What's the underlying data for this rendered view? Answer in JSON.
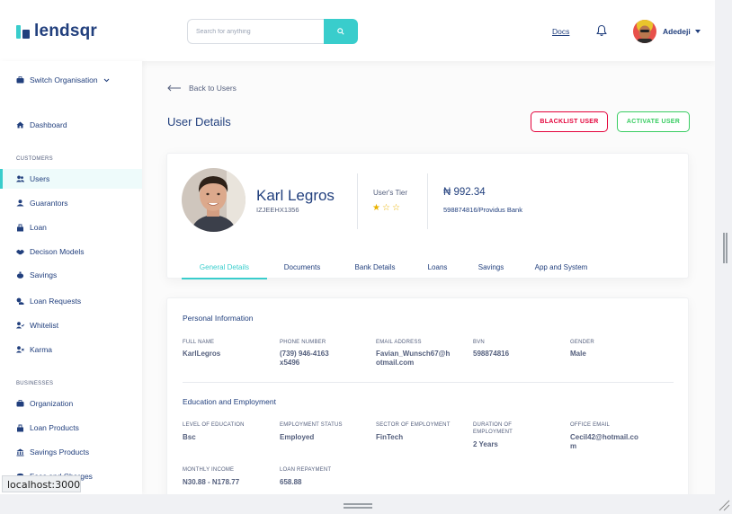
{
  "brand": {
    "name": "lendsqr"
  },
  "topbar": {
    "search_placeholder": "Search for anything",
    "docs": "Docs",
    "user_name": "Adedeji"
  },
  "sidebar": {
    "switch_org": "Switch Organisation",
    "dashboard": "Dashboard",
    "sections": {
      "customers": "CUSTOMERS",
      "businesses": "BUSINESSES"
    },
    "customers": [
      {
        "label": "Users",
        "icon": "users-icon",
        "active": true
      },
      {
        "label": "Guarantors",
        "icon": "guarantors-icon"
      },
      {
        "label": "Loan",
        "icon": "loan-icon"
      },
      {
        "label": "Decison Models",
        "icon": "handshake-icon"
      },
      {
        "label": "Savings",
        "icon": "piggy-bank-icon"
      },
      {
        "label": "Loan Requests",
        "icon": "loan-request-icon"
      },
      {
        "label": "Whitelist",
        "icon": "user-check-icon"
      },
      {
        "label": "Karma",
        "icon": "user-times-icon"
      }
    ],
    "businesses": [
      {
        "label": "Organization",
        "icon": "briefcase-icon"
      },
      {
        "label": "Loan Products",
        "icon": "loan-products-icon"
      },
      {
        "label": "Savings Products",
        "icon": "bank-icon"
      },
      {
        "label": "Fees and Charges",
        "icon": "coins-icon"
      }
    ]
  },
  "page": {
    "back": "Back to Users",
    "title": "User Details",
    "blacklist": "BLACKLIST USER",
    "activate": "ACTIVATE USER"
  },
  "profile": {
    "name": "Karl Legros",
    "id": "IZJEEHX1356",
    "tier_label": "User's Tier",
    "tier_rating": 1,
    "tier_max": 3,
    "balance": "₦ 992.34",
    "bank": "598874816/Providus Bank"
  },
  "tabs": [
    {
      "label": "General Details",
      "active": true
    },
    {
      "label": "Documents"
    },
    {
      "label": "Bank Details"
    },
    {
      "label": "Loans"
    },
    {
      "label": "Savings"
    },
    {
      "label": "App and System"
    }
  ],
  "personal": {
    "title": "Personal Information",
    "fields": [
      {
        "label": "FULL NAME",
        "value": "KarlLegros"
      },
      {
        "label": "PHONE NUMBER",
        "value": "(739) 946-4163\nx5496"
      },
      {
        "label": "EMAIL ADDRESS",
        "value": "Favian_Wunsch67@h\notmail.com"
      },
      {
        "label": "BVN",
        "value": "598874816"
      },
      {
        "label": "GENDER",
        "value": "Male"
      }
    ]
  },
  "education": {
    "title": "Education and Employment",
    "fields": [
      {
        "label": "LEVEL OF EDUCATION",
        "value": "Bsc"
      },
      {
        "label": "EMPLOYMENT STATUS",
        "value": "Employed"
      },
      {
        "label": "SECTOR OF EMPLOYMENT",
        "value": "FinTech"
      },
      {
        "label": "DURATION OF\nEMPLOYMENT",
        "value": "2 Years"
      },
      {
        "label": "OFFICE EMAIL",
        "value": "Cecil42@hotmail.co\nm"
      },
      {
        "label": "MONTHLY INCOME",
        "value": "N30.88 - N178.77"
      },
      {
        "label": "LOAN REPAYMENT",
        "value": "658.88"
      }
    ]
  },
  "browser": {
    "status_url": "localhost:3000"
  },
  "colors": {
    "primary": "#213F7D",
    "accent": "#39CDCC",
    "danger": "#E4033B",
    "success": "#39CD62",
    "star": "#E9B200"
  }
}
